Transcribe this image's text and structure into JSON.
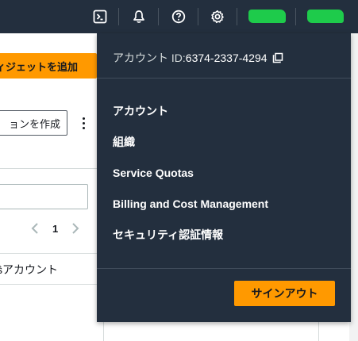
{
  "topbar": {
    "icons": [
      "cloudshell-icon",
      "notifications-icon",
      "help-icon",
      "settings-icon"
    ],
    "region_redacted_color": "#1ecb4b",
    "account_redacted_color": "#1ecb4b"
  },
  "background": {
    "add_widget_label": "ィジェットを追加",
    "create_label": "ョンを作成",
    "page_number": "1",
    "column_header": "ŝアカウント"
  },
  "menu": {
    "account_label": "アカウント ID: ",
    "account_id": "6374-2337-4294",
    "items": [
      {
        "label": "アカウント"
      },
      {
        "label": "組織"
      },
      {
        "label": "Service Quotas"
      },
      {
        "label": "Billing and Cost Management"
      },
      {
        "label": "セキュリティ認証情報"
      }
    ],
    "signout_label": "サインアウト"
  },
  "colors": {
    "nav_bg": "#232f3e",
    "accent": "#ff9900"
  }
}
